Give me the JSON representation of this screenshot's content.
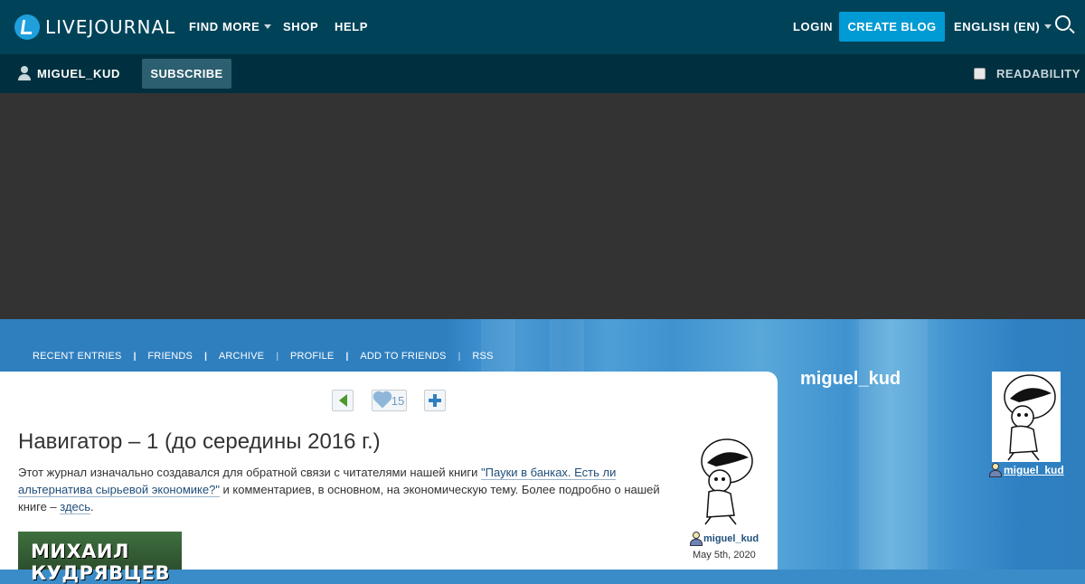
{
  "header": {
    "logo_text": "LIVEJOURNAL",
    "nav": [
      {
        "label": "FIND MORE",
        "has_dropdown": true
      },
      {
        "label": "SHOP"
      },
      {
        "label": "HELP"
      }
    ],
    "login_label": "LOGIN",
    "create_blog_label": "CREATE BLOG",
    "language_label": "ENGLISH (EN)",
    "search_icon": "search-icon"
  },
  "subheader": {
    "username": "MIGUEL_KUD",
    "subscribe_label": "SUBSCRIBE",
    "readability_label": "READABILITY",
    "readability_checked": false
  },
  "journal_nav": {
    "items": [
      "RECENT ENTRIES",
      "FRIENDS",
      "ARCHIVE",
      "PROFILE",
      "ADD TO FRIENDS",
      "RSS"
    ]
  },
  "post": {
    "like_count": "15",
    "title": "Навигатор – 1 (до середины 2016 г.)",
    "text_before_link": "Этот журнал изначально создавался для обратной связи с читателями нашей книги ",
    "book_link": "\"Пауки в банках. Есть ли альтернатива сырьевой экономике?\"",
    "text_after_link": " и комментариев, в основном, на экономическую тему. Более подробно о нашей книге – ",
    "here_link": "здесь",
    "text_end": ".",
    "book_cover_text": "МИХАИЛ КУДРЯВЦЕВ",
    "author": "miguel_kud",
    "date": "May 5th, 2020"
  },
  "sidebar": {
    "journal_name": "miguel_kud",
    "author": "miguel_kud"
  },
  "colors": {
    "topbar": "#004359",
    "subbar": "#00303f",
    "accent": "#009ad4",
    "banner": "#333333",
    "blue_bg": "#3a8cc8"
  }
}
